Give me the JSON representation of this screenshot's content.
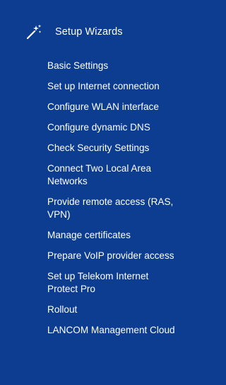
{
  "menu": {
    "header": {
      "label": "Setup Wizards",
      "icon": "magic-wand-icon"
    },
    "items": [
      {
        "lines": [
          "Basic Settings"
        ]
      },
      {
        "lines": [
          "Set up Internet connection"
        ]
      },
      {
        "lines": [
          "Configure WLAN interface"
        ]
      },
      {
        "lines": [
          "Configure dynamic DNS"
        ]
      },
      {
        "lines": [
          "Check Security Settings"
        ]
      },
      {
        "lines": [
          "Connect Two Local Area",
          "Networks"
        ]
      },
      {
        "lines": [
          "Provide remote access (RAS,",
          "VPN)"
        ]
      },
      {
        "lines": [
          "Manage certificates"
        ]
      },
      {
        "lines": [
          "Prepare VoIP provider access"
        ]
      },
      {
        "lines": [
          "Set up Telekom Internet",
          "Protect Pro"
        ]
      },
      {
        "lines": [
          "Rollout"
        ]
      },
      {
        "lines": [
          "LANCOM Management Cloud"
        ]
      }
    ]
  },
  "colors": {
    "background": "#0c3d91",
    "text": "#ffffff"
  }
}
